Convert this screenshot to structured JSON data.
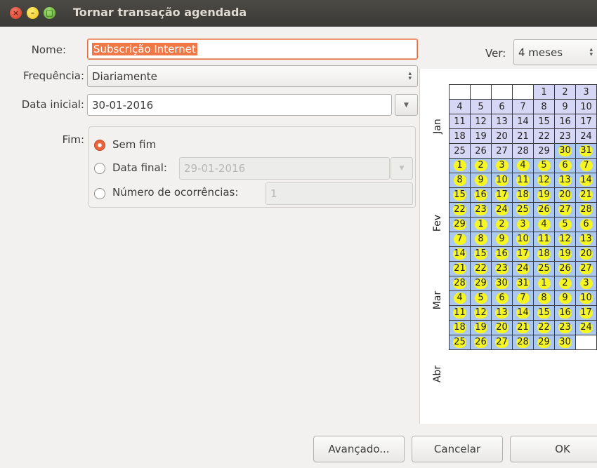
{
  "window": {
    "title": "Tornar transação agendada"
  },
  "form": {
    "name_label": "Nome:",
    "name_value": "Subscrição Internet",
    "frequency_label": "Frequência:",
    "frequency_value": "Diariamente",
    "start_label": "Data inicial:",
    "start_value": "30-01-2016",
    "end_label": "Fim:",
    "end_options": {
      "no_end": "Sem fim",
      "end_date": "Data final:",
      "end_date_value": "29-01-2016",
      "occurrences": "Número de ocorrências:",
      "occurrences_value": "1"
    },
    "selected_end_option": "no_end"
  },
  "calendar": {
    "view_label": "Ver:",
    "view_value": "4 meses",
    "months": [
      "Jan",
      "Fev",
      "Mar",
      "Abr"
    ],
    "rows": [
      [
        [
          "",
          ""
        ],
        [
          "",
          ""
        ],
        [
          "",
          ""
        ],
        [
          "",
          ""
        ],
        [
          "1",
          "jan"
        ],
        [
          "2",
          "jan"
        ],
        [
          "3",
          "jan"
        ]
      ],
      [
        [
          "4",
          "jan"
        ],
        [
          "5",
          "jan"
        ],
        [
          "6",
          "jan"
        ],
        [
          "7",
          "jan"
        ],
        [
          "8",
          "jan"
        ],
        [
          "9",
          "jan"
        ],
        [
          "10",
          "jan"
        ]
      ],
      [
        [
          "11",
          "jan"
        ],
        [
          "12",
          "jan"
        ],
        [
          "13",
          "jan"
        ],
        [
          "14",
          "jan"
        ],
        [
          "15",
          "jan"
        ],
        [
          "16",
          "jan"
        ],
        [
          "17",
          "jan"
        ]
      ],
      [
        [
          "18",
          "jan"
        ],
        [
          "19",
          "jan"
        ],
        [
          "20",
          "jan"
        ],
        [
          "21",
          "jan"
        ],
        [
          "22",
          "jan"
        ],
        [
          "23",
          "jan"
        ],
        [
          "24",
          "jan"
        ]
      ],
      [
        [
          "25",
          "jan"
        ],
        [
          "26",
          "jan"
        ],
        [
          "27",
          "jan"
        ],
        [
          "28",
          "jan"
        ],
        [
          "29",
          "jan"
        ],
        [
          "30",
          "sched"
        ],
        [
          "31",
          "sched"
        ]
      ],
      [
        [
          "1",
          "sched"
        ],
        [
          "2",
          "sched"
        ],
        [
          "3",
          "sched"
        ],
        [
          "4",
          "sched"
        ],
        [
          "5",
          "sched"
        ],
        [
          "6",
          "sched"
        ],
        [
          "7",
          "sched"
        ]
      ],
      [
        [
          "8",
          "sched"
        ],
        [
          "9",
          "sched"
        ],
        [
          "10",
          "sched"
        ],
        [
          "11",
          "sched"
        ],
        [
          "12",
          "sched"
        ],
        [
          "13",
          "sched"
        ],
        [
          "14",
          "sched"
        ]
      ],
      [
        [
          "15",
          "sched"
        ],
        [
          "16",
          "sched"
        ],
        [
          "17",
          "sched"
        ],
        [
          "18",
          "sched"
        ],
        [
          "19",
          "sched"
        ],
        [
          "20",
          "sched"
        ],
        [
          "21",
          "sched"
        ]
      ],
      [
        [
          "22",
          "sched"
        ],
        [
          "23",
          "sched"
        ],
        [
          "24",
          "sched"
        ],
        [
          "25",
          "sched"
        ],
        [
          "26",
          "sched"
        ],
        [
          "27",
          "sched"
        ],
        [
          "28",
          "sched"
        ]
      ],
      [
        [
          "29",
          "sched"
        ],
        [
          "1",
          "sched"
        ],
        [
          "2",
          "sched"
        ],
        [
          "3",
          "sched"
        ],
        [
          "4",
          "sched"
        ],
        [
          "5",
          "sched"
        ],
        [
          "6",
          "sched"
        ]
      ],
      [
        [
          "7",
          "sched"
        ],
        [
          "8",
          "sched"
        ],
        [
          "9",
          "sched"
        ],
        [
          "10",
          "sched"
        ],
        [
          "11",
          "sched"
        ],
        [
          "12",
          "sched"
        ],
        [
          "13",
          "sched"
        ]
      ],
      [
        [
          "14",
          "sched"
        ],
        [
          "15",
          "sched"
        ],
        [
          "16",
          "sched"
        ],
        [
          "17",
          "sched"
        ],
        [
          "18",
          "sched"
        ],
        [
          "19",
          "sched"
        ],
        [
          "20",
          "sched"
        ]
      ],
      [
        [
          "21",
          "sched"
        ],
        [
          "22",
          "sched"
        ],
        [
          "23",
          "sched"
        ],
        [
          "24",
          "sched"
        ],
        [
          "25",
          "sched"
        ],
        [
          "26",
          "sched"
        ],
        [
          "27",
          "sched"
        ]
      ],
      [
        [
          "28",
          "sched"
        ],
        [
          "29",
          "sched"
        ],
        [
          "30",
          "sched"
        ],
        [
          "31",
          "sched"
        ],
        [
          "1",
          "sched"
        ],
        [
          "2",
          "sched"
        ],
        [
          "3",
          "sched"
        ]
      ],
      [
        [
          "4",
          "sched"
        ],
        [
          "5",
          "sched"
        ],
        [
          "6",
          "sched"
        ],
        [
          "7",
          "sched"
        ],
        [
          "8",
          "sched"
        ],
        [
          "9",
          "sched"
        ],
        [
          "10",
          "sched"
        ]
      ],
      [
        [
          "11",
          "sched"
        ],
        [
          "12",
          "sched"
        ],
        [
          "13",
          "sched"
        ],
        [
          "14",
          "sched"
        ],
        [
          "15",
          "sched"
        ],
        [
          "16",
          "sched"
        ],
        [
          "17",
          "sched"
        ]
      ],
      [
        [
          "18",
          "sched"
        ],
        [
          "19",
          "sched"
        ],
        [
          "20",
          "sched"
        ],
        [
          "21",
          "sched"
        ],
        [
          "22",
          "sched"
        ],
        [
          "23",
          "sched"
        ],
        [
          "24",
          "sched"
        ]
      ],
      [
        [
          "25",
          "sched"
        ],
        [
          "26",
          "sched"
        ],
        [
          "27",
          "sched"
        ],
        [
          "28",
          "sched"
        ],
        [
          "29",
          "sched"
        ],
        [
          "30",
          "sched"
        ],
        [
          "",
          ""
        ]
      ]
    ]
  },
  "buttons": {
    "advanced": "Avançado...",
    "cancel": "Cancelar",
    "ok": "OK"
  },
  "colors": {
    "accent": "#f07746",
    "highlight_dot": "#f5f524",
    "month_cell": "#acc7f0",
    "january_cell": "#d6d6f5"
  }
}
